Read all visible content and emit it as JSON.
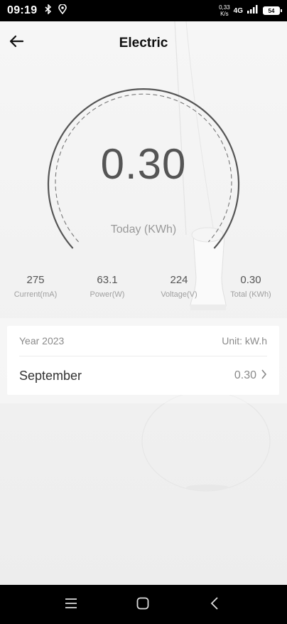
{
  "status_bar": {
    "time": "09:19",
    "net_speed_value": "0,33",
    "net_speed_unit": "K/s",
    "network": "4G",
    "battery": "54",
    "icons": [
      "bluetooth-icon",
      "location-icon",
      "signal-icon",
      "battery-icon"
    ]
  },
  "header": {
    "title": "Electric"
  },
  "gauge": {
    "value": "0.30",
    "label": "Today (KWh)"
  },
  "stats": [
    {
      "value": "275",
      "label": "Current(mA)"
    },
    {
      "value": "63.1",
      "label": "Power(W)"
    },
    {
      "value": "224",
      "label": "Voltage(V)"
    },
    {
      "value": "0.30",
      "label": "Total (KWh)"
    }
  ],
  "record": {
    "year": "Year 2023",
    "unit": "Unit: kW.h",
    "month": "September",
    "month_value": "0.30"
  },
  "colors": {
    "accent": "#555555",
    "muted": "#999999",
    "background": "#f1f1f1"
  }
}
